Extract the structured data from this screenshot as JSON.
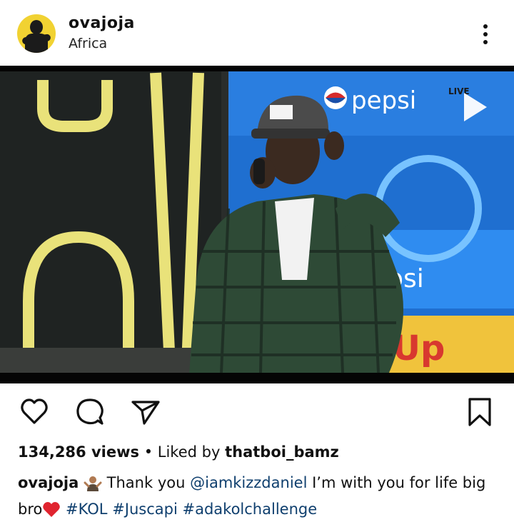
{
  "post": {
    "username": "ovajoja",
    "location": "Africa",
    "avatar_icon": "avatar-icon",
    "more_icon": "more-vertical-icon"
  },
  "media": {
    "type": "video",
    "overlay_text_1": "pepsi",
    "overlay_text_2": "epsi",
    "overlay_text_3": "Up",
    "badge": "LIVE",
    "play_icon": "play-icon"
  },
  "actions": {
    "like_icon": "heart-icon",
    "comment_icon": "comment-icon",
    "share_icon": "send-icon",
    "save_icon": "bookmark-icon"
  },
  "stats": {
    "views": "134,286 views",
    "separator": "•",
    "liked_by_prefix": "Liked by",
    "liked_by_user": "thatboi_bamz"
  },
  "caption": {
    "username": "ovajoja",
    "text_1": "Thank you",
    "mention": "@iamkizzdaniel",
    "text_2": "I’m with you for life big bro",
    "hashtags": [
      "#KOL",
      "#Juscapi",
      "#adakolchallenge"
    ]
  },
  "colors": {
    "link": "#0f3f6e",
    "heart": "#e0242f",
    "pepsi_blue": "#1d74d6"
  }
}
